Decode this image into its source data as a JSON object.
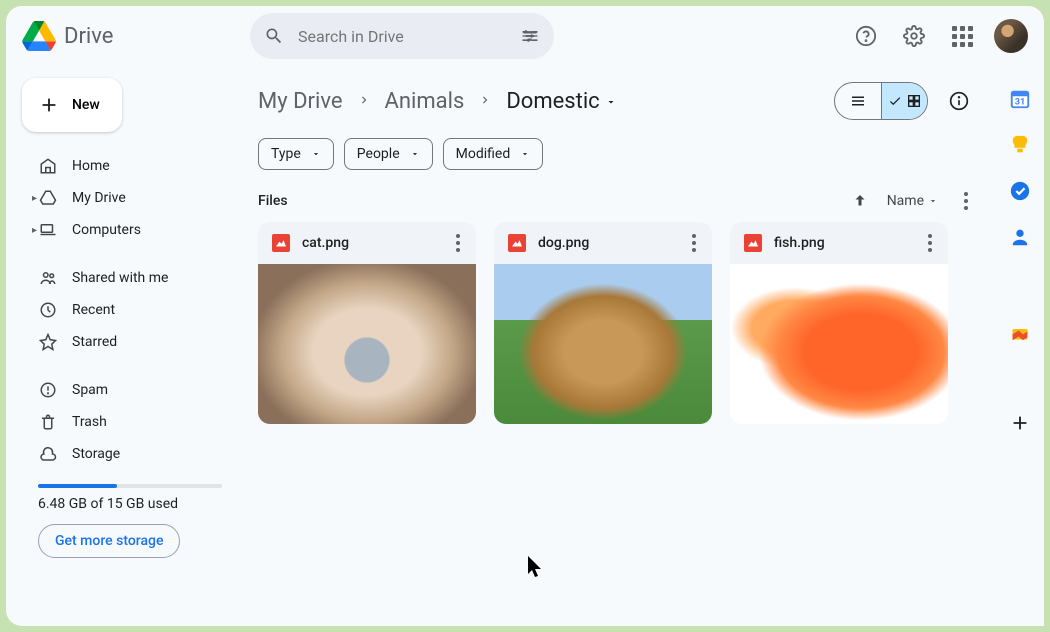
{
  "app": {
    "name": "Drive"
  },
  "search": {
    "placeholder": "Search in Drive"
  },
  "new_button": {
    "label": "New"
  },
  "sidebar": {
    "items": [
      {
        "icon": "home-icon",
        "label": "Home"
      },
      {
        "icon": "drive-icon",
        "label": "My Drive"
      },
      {
        "icon": "computers-icon",
        "label": "Computers"
      },
      {
        "icon": "shared-icon",
        "label": "Shared with me"
      },
      {
        "icon": "recent-icon",
        "label": "Recent"
      },
      {
        "icon": "starred-icon",
        "label": "Starred"
      },
      {
        "icon": "spam-icon",
        "label": "Spam"
      },
      {
        "icon": "trash-icon",
        "label": "Trash"
      },
      {
        "icon": "storage-icon",
        "label": "Storage"
      }
    ],
    "storage": {
      "used_gb": 6.48,
      "total_gb": 15,
      "text": "6.48 GB of 15 GB used",
      "fill_percent": 43,
      "button_label": "Get more storage"
    }
  },
  "breadcrumb": [
    "My Drive",
    "Animals",
    "Domestic"
  ],
  "filters": [
    "Type",
    "People",
    "Modified"
  ],
  "section_label": "Files",
  "sort": {
    "label": "Name"
  },
  "files": [
    {
      "name": "cat.png",
      "thumb_class": "cat"
    },
    {
      "name": "dog.png",
      "thumb_class": "dog"
    },
    {
      "name": "fish.png",
      "thumb_class": "fish"
    }
  ],
  "right_panel": [
    "calendar",
    "keep",
    "tasks",
    "contacts",
    "maps",
    "add"
  ]
}
